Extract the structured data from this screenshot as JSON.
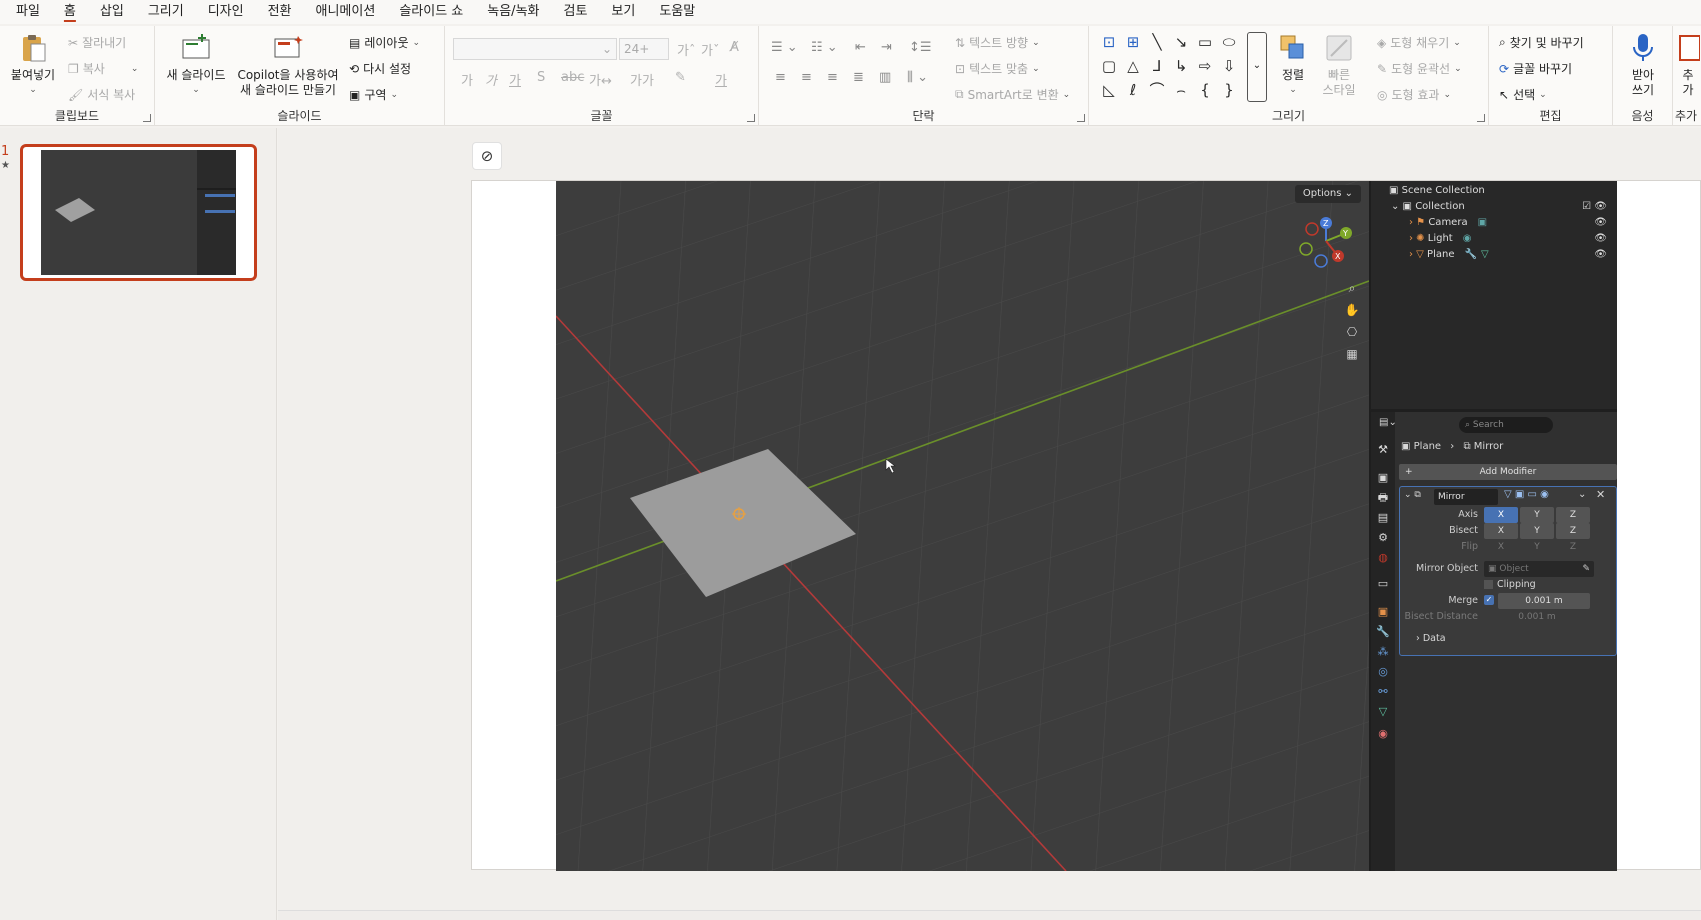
{
  "menu": [
    "파일",
    "홈",
    "삽입",
    "그리기",
    "디자인",
    "전환",
    "애니메이션",
    "슬라이드 쇼",
    "녹음/녹화",
    "검토",
    "보기",
    "도움말"
  ],
  "ribbon": {
    "clipboard": {
      "label": "클립보드",
      "paste": "붙여넣기",
      "cut": "잘라내기",
      "copy": "복사",
      "format_painter": "서식 복사"
    },
    "slides": {
      "label": "슬라이드",
      "new_slide": "새 슬라이드",
      "copilot_line1": "Copilot을 사용하여",
      "copilot_line2": "새 슬라이드 만들기",
      "layout": "레이아웃",
      "reset": "다시 설정",
      "section": "구역"
    },
    "font": {
      "label": "글꼴",
      "size_placeholder": "24+"
    },
    "paragraph": {
      "label": "단락",
      "text_direction": "텍스트 방향",
      "align_text": "텍스트 맞춤",
      "smartart": "SmartArt로 변환"
    },
    "drawing": {
      "label": "그리기",
      "arrange": "정렬",
      "quick_styles_1": "빠른",
      "quick_styles_2": "스타일",
      "shape_fill": "도형 채우기",
      "shape_outline": "도형 윤곽선",
      "shape_effects": "도형 효과"
    },
    "editing": {
      "label": "편집",
      "find_replace": "찾기 및 바꾸기",
      "replace_font": "글꼴 바꾸기",
      "select": "선택"
    },
    "voice": {
      "label": "음성",
      "dictate_1": "받아",
      "dictate_2": "쓰기"
    },
    "addins": {
      "label": "추가",
      "btn_1": "추",
      "btn_2": "가"
    }
  },
  "slides_pane": {
    "slide_number": "1",
    "slide_marker": "★"
  },
  "blender": {
    "options": "Options",
    "outliner": {
      "root": "Scene Collection",
      "collection": "Collection",
      "items": [
        "Camera",
        "Light",
        "Plane"
      ]
    },
    "properties": {
      "search_placeholder": "Search",
      "breadcrumb_object": "Plane",
      "breadcrumb_modifier": "Mirror",
      "add_modifier": "Add Modifier",
      "modifier_name": "Mirror",
      "axis_label": "Axis",
      "bisect_label": "Bisect",
      "flip_label": "Flip",
      "x": "X",
      "y": "Y",
      "z": "Z",
      "mirror_object_label": "Mirror Object",
      "mirror_object_placeholder": "Object",
      "clipping_label": "Clipping",
      "merge_label": "Merge",
      "merge_value": "0.001 m",
      "bisect_distance_label": "Bisect Distance",
      "bisect_distance_value": "0.001 m",
      "data_label": "Data"
    }
  },
  "colors": {
    "accent": "#c43e1c",
    "blender_blue": "#4772b3",
    "x_axis": "#b33a3a",
    "y_axis": "#6a8f2a"
  }
}
